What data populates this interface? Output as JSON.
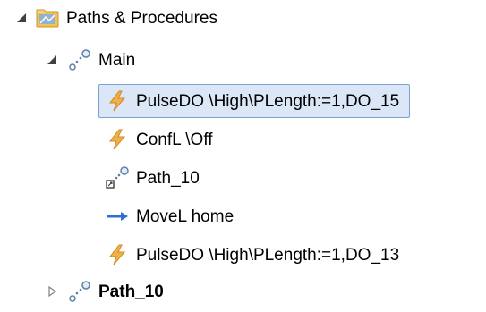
{
  "colors": {
    "selection_bg": "#dbe6f7",
    "selection_border": "#7da2ce",
    "expander": "#404040",
    "node_dot": "#8aa6c8",
    "instruction": "#e8a43a",
    "move_arrow": "#2f6fd6"
  },
  "tree": {
    "root": {
      "label": "Paths & Procedures",
      "icon": "folder-icon",
      "expanded": true
    },
    "main": {
      "label": "Main",
      "icon": "path-node-icon",
      "expanded": true
    },
    "main_items": [
      {
        "label": "PulseDO \\High\\PLength:=1,DO_15",
        "icon": "lightning-icon",
        "selected": true
      },
      {
        "label": "ConfL \\Off",
        "icon": "lightning-icon",
        "selected": false
      },
      {
        "label": "Path_10",
        "icon": "path-call-icon",
        "selected": false
      },
      {
        "label": "MoveL home",
        "icon": "arrow-right-icon",
        "selected": false
      },
      {
        "label": "PulseDO \\High\\PLength:=1,DO_13",
        "icon": "lightning-icon",
        "selected": false
      }
    ],
    "path10": {
      "label": "Path_10",
      "icon": "path-node-icon",
      "expanded": false
    }
  }
}
